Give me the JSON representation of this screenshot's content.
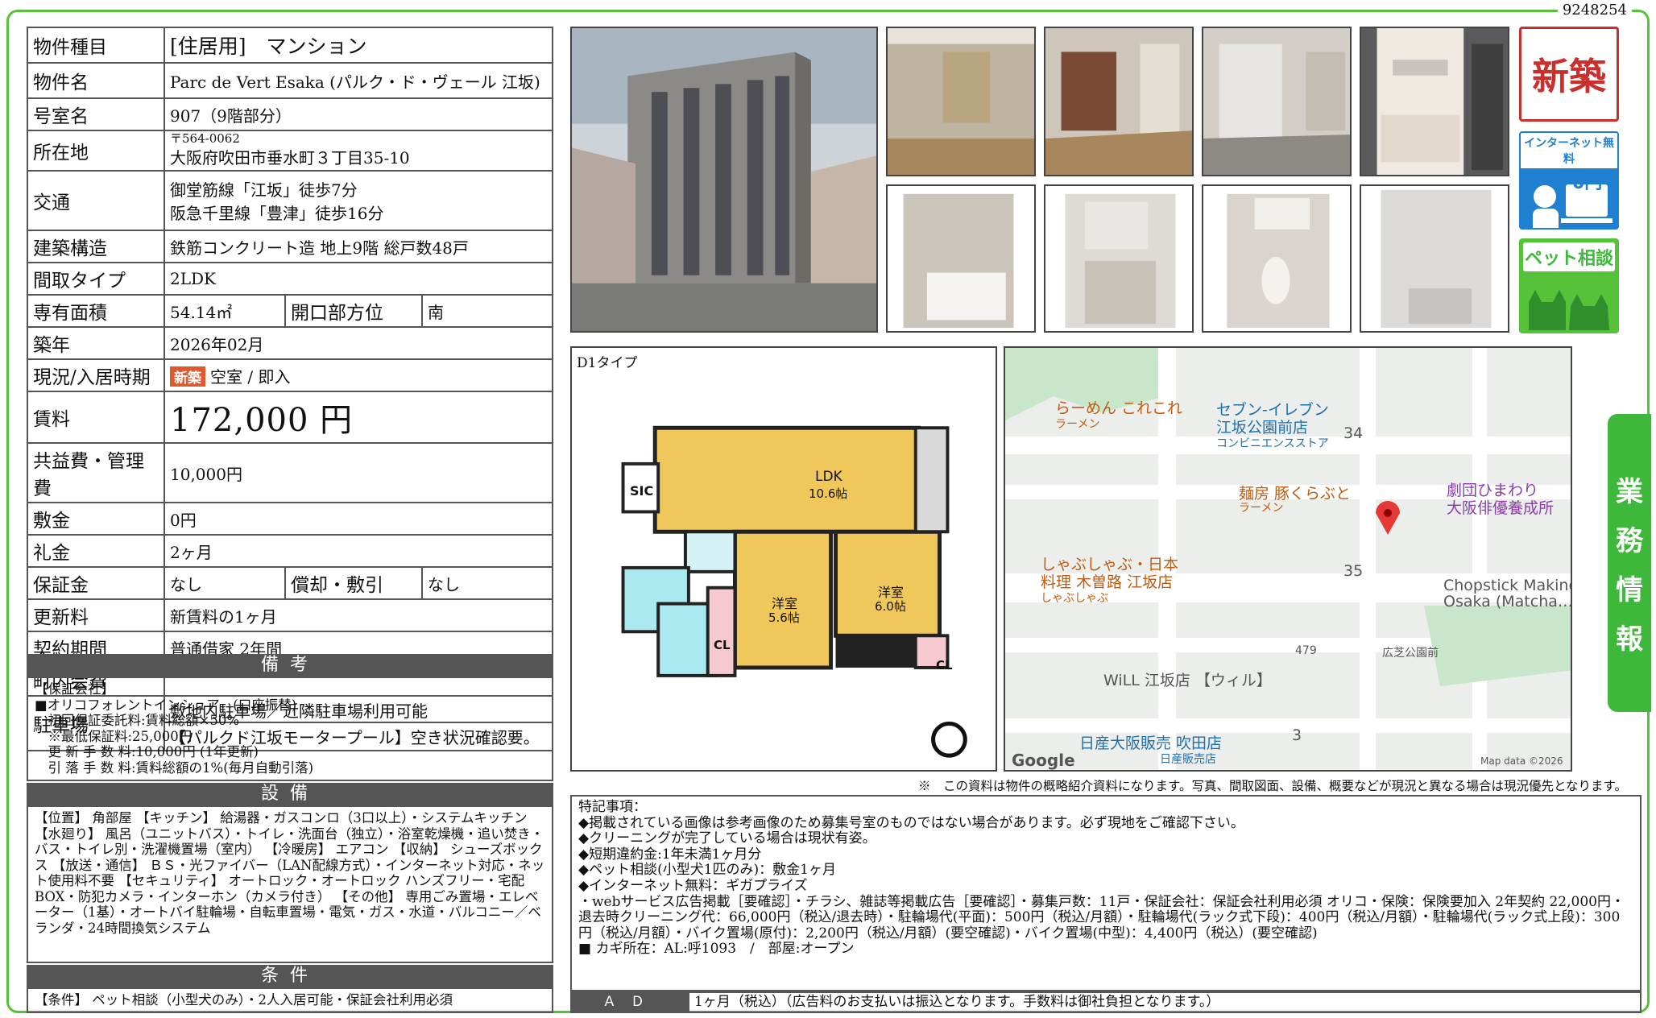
{
  "doc_id": "9248254",
  "spec": {
    "type_label": "物件種目",
    "type_value": "[住居用]　マンション",
    "name_label": "物件名",
    "name_value": "Parc de Vert Esaka (パルク・ド・ヴェール 江坂)",
    "room_label": "号室名",
    "room_value": "907（9階部分）",
    "addr_label": "所在地",
    "addr_zip": "〒564-0062",
    "addr_value": "大阪府吹田市垂水町３丁目35-10",
    "traffic_label": "交通",
    "traffic_1": "御堂筋線「江坂」徒歩7分",
    "traffic_2": "阪急千里線「豊津」徒歩16分",
    "struct_label": "建築構造",
    "struct_value": "鉄筋コンクリート造 地上9階 総戸数48戸",
    "layout_label": "間取タイプ",
    "layout_value": "2LDK",
    "area_label": "専有面積",
    "area_value": "54.14㎡",
    "dir_label": "開口部方位",
    "dir_value": "南",
    "built_label": "築年",
    "built_value": "2026年02月",
    "status_label": "現況/入居時期",
    "status_tag": "新築",
    "status_value": "空室 / 即入",
    "rent_label": "賃料",
    "rent_value": "172,000 円",
    "fee_label": "共益費・管理費",
    "fee_value": "10,000円",
    "deposit_label": "敷金",
    "deposit_value": "0円",
    "keymoney_label": "礼金",
    "keymoney_value": "2ヶ月",
    "guarantee_label": "保証金",
    "guarantee_value": "なし",
    "amort_label": "償却・敷引",
    "amort_value": "なし",
    "renew_label": "更新料",
    "renew_value": "新賃料の1ヶ月",
    "contract_label": "契約期間",
    "contract_value": "普通借家 2年間",
    "town_label": "町内会費",
    "town_value": "",
    "parking_label": "駐車場",
    "parking_1": "敷地内駐車場／近隣駐車場利用可能",
    "parking_2": "【パルクド江坂モータープール】空き状況確認要。"
  },
  "biko": {
    "title": "備考",
    "text": "【保証会社】\n■オリコフォレントインシュア　(口座振替)\n　初回保証委託料:賃料総額×50%\n　※最低保証料:25,000円\n　更 新 手 数 料:10,000円 (1年更新)\n　引 落 手 数 料:賃料総額の1%(毎月自動引落)"
  },
  "setsubi": {
    "title": "設備",
    "text": "【位置】 角部屋 【キッチン】 給湯器・ガスコンロ（3口以上）・システムキッチン 【水廻り】 風呂（ユニットバス）・トイレ・洗面台（独立）・浴室乾燥機・追い焚き・バス・トイレ別・洗濯機置場（室内） 【冷暖房】 エアコン 【収納】 シューズボックス 【放送・通信】 ＢＳ・光ファイバー（LAN配線方式）・インターネット対応・ネット使用料不要 【セキュリティ】 オートロック・オートロック ハンズフリー・宅配BOX・防犯カメラ・インターホン（カメラ付き） 【その他】 専用ごみ置場・エレベーター（1基）・オートバイ駐輪場・自転車置場・電気・ガス・水道・バルコニー／ベランダ・24時間換気システム"
  },
  "jouken": {
    "title": "条件",
    "text": "【条件】 ペット相談（小型犬のみ）・2人入居可能・保証会社利用必須"
  },
  "badges": {
    "new": "新築",
    "internet": "インターネット無料",
    "internet_fee": "0円",
    "pet": "ペット相談"
  },
  "plan": {
    "caption": "D1タイプ",
    "ldk": "LDK",
    "ldk_size": "10.6帖",
    "room1": "洋室",
    "room1_size": "5.6帖",
    "room2": "洋室",
    "room2_size": "6.0帖",
    "sic": "SIC",
    "cl1": "CL",
    "cl2": "CL"
  },
  "map": {
    "labels": {
      "ramen": "らーめん これこれ",
      "ramen_sub": "ラーメン",
      "seven": "セブン-イレブン",
      "seven2": "江坂公園前店",
      "seven_sub": "コンビニエンスストア",
      "n34": "34",
      "menbo": "麺房 豚くらぶと",
      "menbo_sub": "ラーメン",
      "gekidan": "劇団ひまわり",
      "gekidan2": "大阪俳優養成所",
      "shabu": "しゃぶしゃぶ・日本",
      "shabu2": "料理 木曽路 江坂店",
      "shabu_sub": "しゃぶしゃぶ",
      "n35": "35",
      "chop": "Chopstick Making",
      "chop2": "Osaka (Matcha…",
      "route": "479",
      "park": "広芝公園前",
      "will": "WiLL 江坂店 【ウィル】",
      "nissan": "日産大阪販売 吹田店",
      "nissan_sub": "日産販売店",
      "n3": "3",
      "google": "Google",
      "mapdata": "Map data ©2026"
    }
  },
  "note": "※　この資料は物件の概略紹介資料になります。写真、間取図面、設備、概要などが現況と異なる場合は現況優先となります。",
  "remarks": "特記事項：\n◆掲載されている画像は参考画像のため募集号室のものではない場合があります。必ず現地をご確認下さい。\n◆クリーニングが完了している場合は現状有姿。\n◆短期違約金:1年未満1ヶ月分\n◆ペット相談(小型犬1匹のみ)：敷金1ヶ月\n◆インターネット無料：ギガプライズ\n・webサービス広告掲載［要確認］・チラシ、雑誌等掲載広告［要確認］・募集戸数：11戸・保証会社：保証会社利用必須 オリコ・保険：保険要加入 2年契約 22,000円・退去時クリーニング代：66,000円（税込/退去時）・駐輪場代(平面)：500円（税込/月額）・駐輪場代(ラック式下段)：400円（税込/月額）・駐輪場代(ラック式上段)：300円（税込/月額）・バイク置場(原付)：2,200円（税込/月額）(要空確認)・バイク置場(中型)：4,400円（税込）(要空確認)\n■ カギ所在：AL:呼1093　/　部屋:オープン",
  "ad": {
    "label": "ＡＤ",
    "value": "1ヶ月（税込）（広告料のお支払いは振込となります。手数料は御社負担となります。）"
  },
  "side_tab": [
    "業",
    "務",
    "情",
    "報"
  ]
}
